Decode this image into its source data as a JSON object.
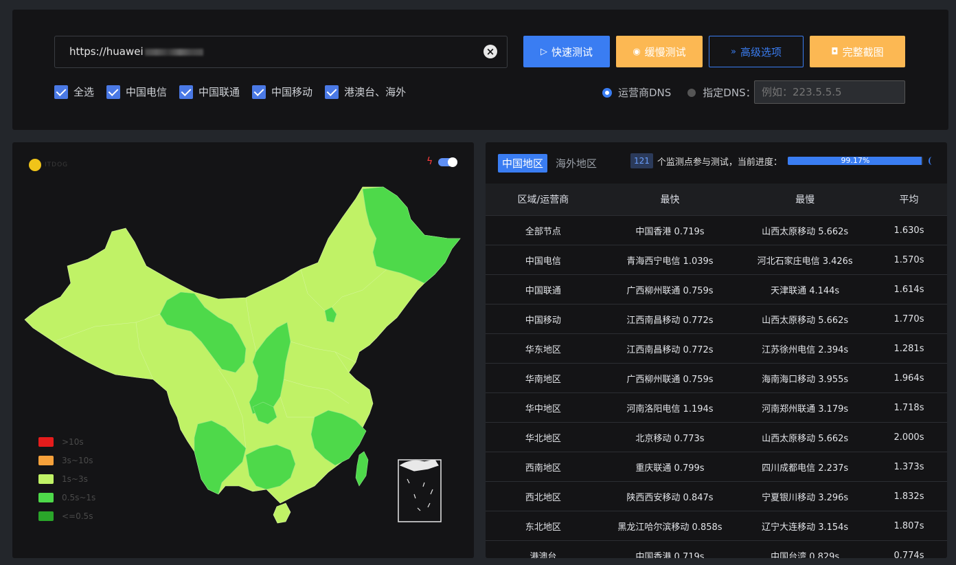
{
  "url_input": {
    "value": "https://huawei"
  },
  "buttons": {
    "quick_test": "快速测试",
    "slow_test": "缓慢测试",
    "advanced": "高级选项",
    "screenshot": "完整截图"
  },
  "checkboxes": [
    "全选",
    "中国电信",
    "中国联通",
    "中国移动",
    "港澳台、海外"
  ],
  "dns": {
    "option_isp": "运营商DNS",
    "option_custom": "指定DNS：",
    "placeholder": "例如：223.5.5.5"
  },
  "map": {
    "legend": [
      {
        "label": ">10s",
        "color": "#e51c1c"
      },
      {
        "label": "3s~10s",
        "color": "#f6a13b"
      },
      {
        "label": "1s~3s",
        "color": "#c0f266"
      },
      {
        "label": "0.5s~1s",
        "color": "#4ed94a"
      },
      {
        "label": "<=0.5s",
        "color": "#2aa52a"
      }
    ]
  },
  "region_tabs": {
    "active": "中国地区",
    "inactive": "海外地区"
  },
  "progress": {
    "node_count": "121",
    "label": "个监测点参与测试，当前进度：",
    "percent_text": "99.17%",
    "fraction": 0.9917
  },
  "table": {
    "headers": [
      "区域/运营商",
      "最快",
      "最慢",
      "平均"
    ],
    "rows": [
      [
        "全部节点",
        "中国香港 0.719s",
        "山西太原移动 5.662s",
        "1.630s"
      ],
      [
        "中国电信",
        "青海西宁电信 1.039s",
        "河北石家庄电信 3.426s",
        "1.570s"
      ],
      [
        "中国联通",
        "广西柳州联通 0.759s",
        "天津联通 4.144s",
        "1.614s"
      ],
      [
        "中国移动",
        "江西南昌移动 0.772s",
        "山西太原移动 5.662s",
        "1.770s"
      ],
      [
        "华东地区",
        "江西南昌移动 0.772s",
        "江苏徐州电信 2.394s",
        "1.281s"
      ],
      [
        "华南地区",
        "广西柳州联通 0.759s",
        "海南海口移动 3.955s",
        "1.964s"
      ],
      [
        "华中地区",
        "河南洛阳电信 1.194s",
        "河南郑州联通 3.179s",
        "1.718s"
      ],
      [
        "华北地区",
        "北京移动 0.773s",
        "山西太原移动 5.662s",
        "2.000s"
      ],
      [
        "西南地区",
        "重庆联通 0.799s",
        "四川成都电信 2.237s",
        "1.373s"
      ],
      [
        "西北地区",
        "陕西西安移动 0.847s",
        "宁夏银川移动 3.296s",
        "1.832s"
      ],
      [
        "东北地区",
        "黑龙江哈尔滨移动 0.858s",
        "辽宁大连移动 3.154s",
        "1.807s"
      ],
      [
        "港澳台",
        "中国香港 0.719s",
        "中国台湾 0.829s",
        "0.774s"
      ]
    ]
  }
}
